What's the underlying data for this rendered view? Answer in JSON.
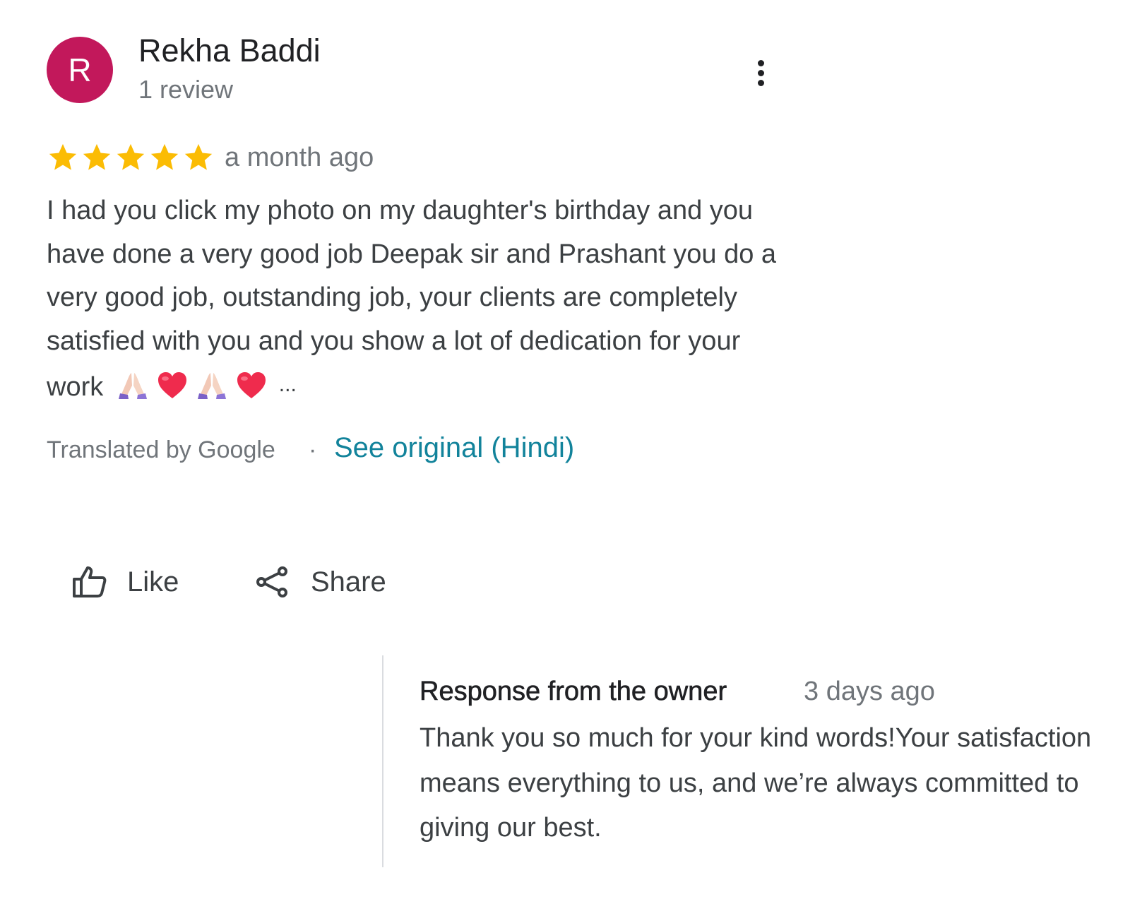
{
  "review": {
    "author": {
      "initial": "R",
      "name": "Rekha Baddi",
      "review_count": "1 review",
      "avatar_color": "#c2185b"
    },
    "more_options_icon": "more-vert-icon",
    "rating": 5,
    "rating_max": 5,
    "star_color": "#fbbc04",
    "date": "a month ago",
    "text": "I had you click my photo on my daughter's birthday and you have done a very good job Deepak sir and Prashant you do a very good job, outstanding job, your clients are completely satisfied with you and you show a lot of dedication for your work",
    "emojis": [
      "folded-hands-emoji",
      "heart-emoji",
      "folded-hands-emoji",
      "heart-emoji"
    ],
    "ellipsis": "...",
    "translation": {
      "label": "Translated by Google",
      "separator": "·",
      "see_original": "See original (Hindi)",
      "link_color": "#12839b"
    },
    "actions": {
      "like_label": "Like",
      "like_icon": "thumb-up-icon",
      "share_label": "Share",
      "share_icon": "share-icon"
    }
  },
  "owner_response": {
    "title": "Response from the owner",
    "date": "3 days ago",
    "text": "Thank you so much for your kind words!Your satisfaction means everything to us, and we’re always committed to giving our best."
  }
}
